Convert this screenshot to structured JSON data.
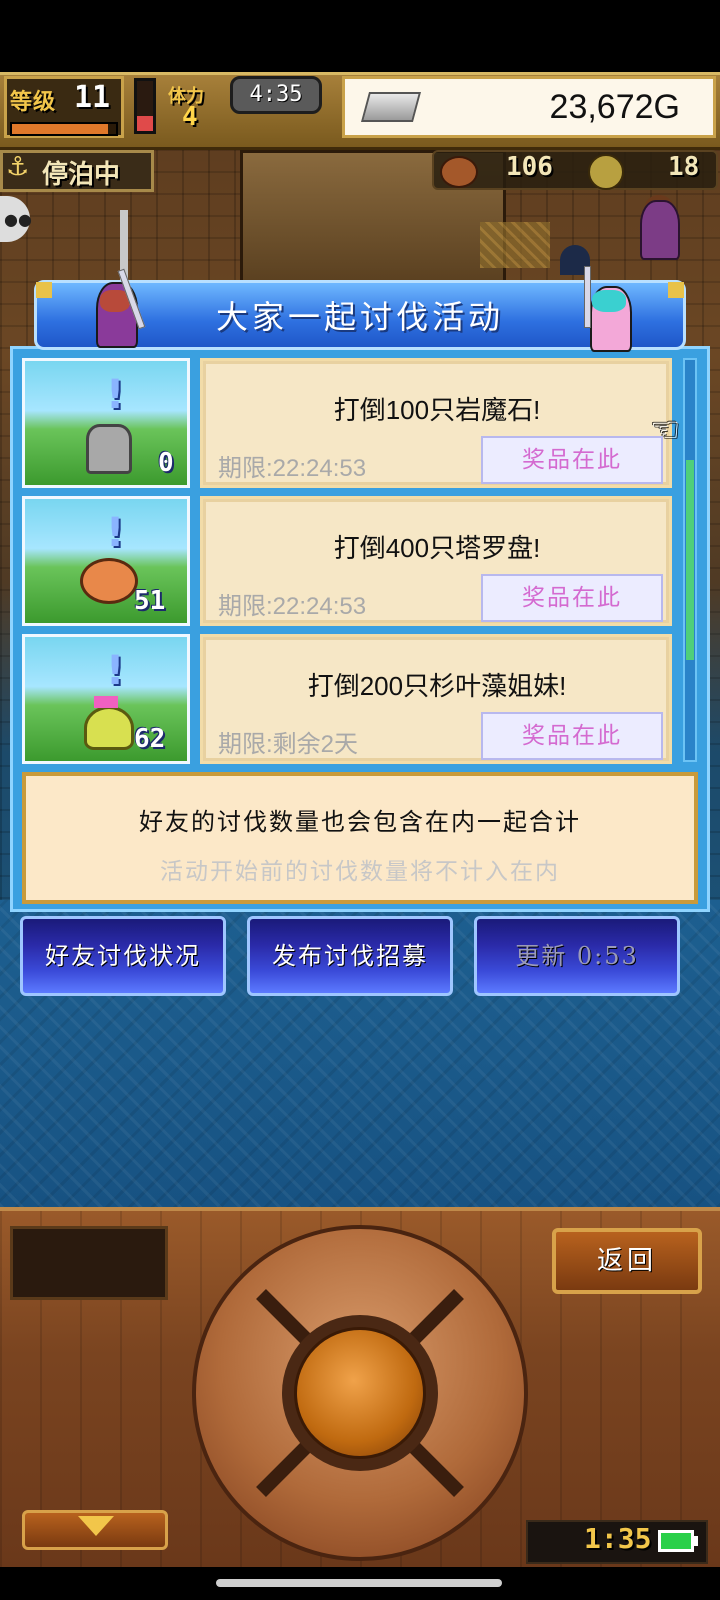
{
  "hud": {
    "level_label": "等级",
    "level": "11",
    "stamina_label": "体力",
    "stamina": "4",
    "timer": "4:35",
    "money": "23,672G",
    "moor_icon": "anchor-icon",
    "moor_status": "停泊中",
    "resource1_icon": "meat-icon",
    "resource1": "106",
    "resource2_icon": "coin-icon",
    "resource2": "18"
  },
  "panel": {
    "title": "大家一起讨伐活动",
    "quests": [
      {
        "title": "打倒100只岩魔石!",
        "deadline": "期限:22:24:53",
        "count": "0",
        "reward_label": "奖品在此"
      },
      {
        "title": "打倒400只塔罗盘!",
        "deadline": "期限:22:24:53",
        "count": "51",
        "reward_label": "奖品在此"
      },
      {
        "title": "打倒200只杉叶藻姐妹!",
        "deadline": "期限:剩余2天",
        "count": "62",
        "reward_label": "奖品在此"
      }
    ],
    "note_main": "好友的讨伐数量也会包含在内一起合计",
    "note_sub": "活动开始前的讨伐数量将不计入在内"
  },
  "buttons": {
    "friend_status": "好友讨伐状况",
    "post_recruit": "发布讨伐招募",
    "refresh": "更新 0:53"
  },
  "console": {
    "back": "返回",
    "clock": "1:35"
  },
  "colors": {
    "panel_blue": "#3aa0e0",
    "title_blue": "#2e70e0",
    "reward_text": "#d46ad0",
    "console_wood": "#7a4420"
  }
}
